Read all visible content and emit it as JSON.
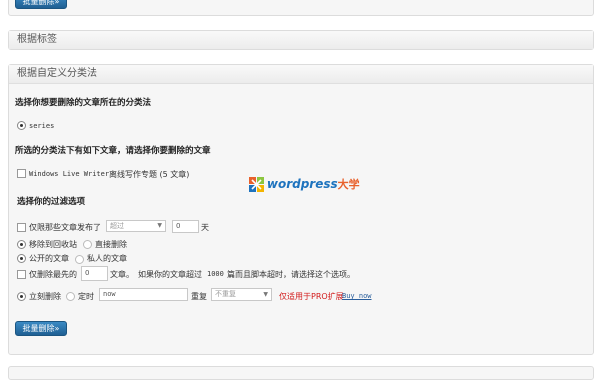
{
  "top_delete_button": "批量删除»",
  "tags_panel": {
    "title": "根据标签"
  },
  "custom_tax_panel": {
    "title": "根据自定义分类法",
    "section1_heading": "选择你想要删除的文章所在的分类法",
    "taxonomy_option": "series",
    "section2_heading": "所选的分类法下有如下文章，请选择你要删除的文章",
    "term_mono": "Windows Live Writer",
    "term_rest": "离线写作专题 (5 文章)",
    "section3_heading": "选择你的过滤选项",
    "filter_date": {
      "label": "仅限那些文章发布了",
      "select": "超过",
      "value": "0",
      "unit": "天"
    },
    "trash_option": "移除到回收站",
    "permanent_option": "直接删除",
    "public_option": "公开的文章",
    "private_option": "私人的文章",
    "limit": {
      "label": "仅删除最先的",
      "value": "0",
      "unit": "文章。",
      "hint_pre": "如果你的文章超过",
      "hint_num": "1000",
      "hint_post": "篇而且脚本超时，请选择这个选项。"
    },
    "schedule": {
      "immediate": "立刻删除",
      "scheduled": "定时",
      "time_value": "now",
      "repeat_label": "重复",
      "repeat_select": "不重复",
      "pro_note": "仅适用于PRO扩展",
      "buy_link": "Buy now"
    },
    "delete_button": "批量删除»"
  },
  "watermark": {
    "word": "wordpress",
    "cn": "大学",
    "colors": [
      "#e8612c",
      "#8cc63f",
      "#1e73be",
      "#f4b400"
    ]
  }
}
